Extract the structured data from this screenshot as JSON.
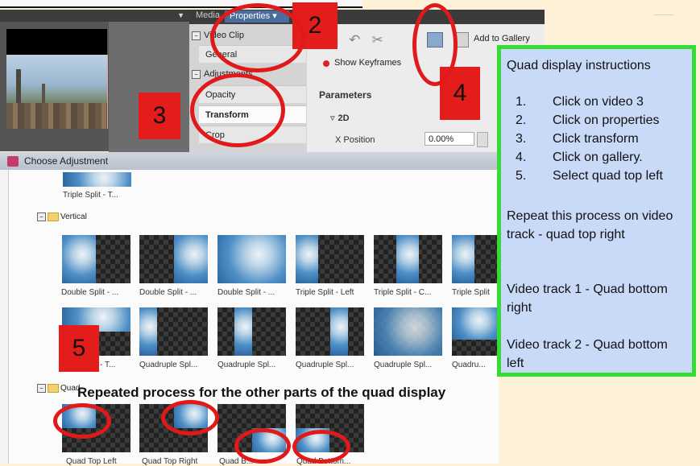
{
  "top_panel": {
    "tabs": [
      "Media",
      "Properties"
    ],
    "properties_tree": {
      "video_clip": "Video Clip",
      "general": "General",
      "adjustments": "Adjustments",
      "opacity": "Opacity",
      "transform": "Transform",
      "crop": "Crop"
    },
    "toolbar": {
      "add_to_gallery": "Add to Gallery",
      "show_keyframes": "Show Keyframes"
    },
    "parameters": {
      "heading": "Parameters",
      "group": "2D",
      "x_position_label": "X Position",
      "x_position_value": "0.00%"
    }
  },
  "dialog": {
    "title": "Choose Adjustment",
    "top_item": "Triple Split - T...",
    "folders": {
      "vertical": "Vertical",
      "quad": "Quad"
    },
    "row1": [
      "Double Split - ...",
      "Double Split - ...",
      "Double Split - ...",
      "Triple Split - Left",
      "Triple Split - C...",
      "Triple Split"
    ],
    "row2": [
      "...it - T...",
      "Quadruple Spl...",
      "Quadruple Spl...",
      "Quadruple Spl...",
      "Quadruple Spl...",
      "Quadru..."
    ],
    "quad_items": [
      "Quad Top Left",
      "Quad Top Right",
      "Quad B...",
      "Quad Bottom..."
    ]
  },
  "annotations": {
    "step_2": "2",
    "step_3": "3",
    "step_4": "4",
    "step_5": "5",
    "banner": "Repeated process for the other parts of the quad display"
  },
  "instructions": {
    "title": "Quad display instructions",
    "steps": [
      {
        "num": "1.",
        "text": "Click on video 3"
      },
      {
        "num": "2.",
        "text": "Click on properties"
      },
      {
        "num": "3.",
        "text": "Click transform"
      },
      {
        "num": "4.",
        "text": "Click on gallery."
      },
      {
        "num": "5.",
        "text": "Select quad top left"
      }
    ],
    "para1": "Repeat this process on video track - quad top right",
    "para2": "Video track 1 - Quad bottom right",
    "para3": "Video track 2 - Quad bottom left"
  },
  "colors": {
    "annotation_red": "#e41c1c",
    "instructions_border": "#33dd33",
    "instructions_bg": "#c9daf8",
    "background": "#fdf1d8"
  }
}
